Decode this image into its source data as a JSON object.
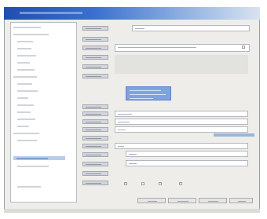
{
  "window": {
    "accent": "#1f4fae",
    "icons": [
      "close-icon"
    ]
  },
  "tree": {
    "items": [
      {
        "state": "normal"
      },
      {
        "state": "normal"
      },
      {
        "state": "normal"
      },
      {
        "state": "normal"
      },
      {
        "state": "normal"
      },
      {
        "state": "normal"
      },
      {
        "state": "normal"
      },
      {
        "state": "normal"
      },
      {
        "state": "normal"
      },
      {
        "state": "normal"
      },
      {
        "state": "normal"
      },
      {
        "state": "normal"
      },
      {
        "state": "normal"
      },
      {
        "state": "normal"
      },
      {
        "state": "normal"
      },
      {
        "state": "normal"
      },
      {
        "state": "normal"
      },
      {
        "state": "selected"
      },
      {
        "state": "normal"
      },
      {
        "state": "normal"
      }
    ]
  },
  "form": {
    "rows": 17,
    "checkboxes": 4
  },
  "buttons": {
    "count": 5
  }
}
